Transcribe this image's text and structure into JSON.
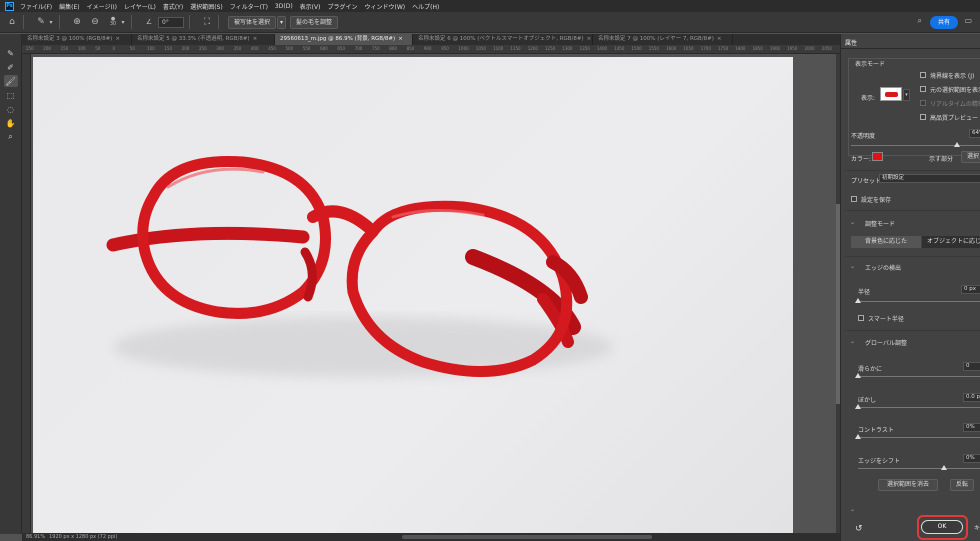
{
  "menu": {
    "logo": "Ps",
    "items": [
      "ファイル(F)",
      "編集(E)",
      "イメージ(I)",
      "レイヤー(L)",
      "書式(Y)",
      "選択範囲(S)",
      "フィルター(T)",
      "3D(D)",
      "表示(V)",
      "プラグイン",
      "ウィンドウ(W)",
      "ヘルプ(H)"
    ]
  },
  "options": {
    "size_value": "30",
    "angle_value": "0°",
    "select_subject": "被写体を選択",
    "refine_hair": "髪の毛を調整",
    "share": "共有"
  },
  "tabs": [
    {
      "label": "名称未設定 3 @ 100% (RGB/8#)",
      "active": false
    },
    {
      "label": "名称未設定 5 @ 33.3% (不透過明, RGB/8#)",
      "active": false
    },
    {
      "label": "29560613_m.jpg @ 86.9% (背景, RGB/8#)",
      "active": true
    },
    {
      "label": "名称未設定 6 @ 100% (ベクトルスマートオブジェクト, RGB/8#)",
      "active": false
    },
    {
      "label": "名称未設定 7 @ 100% (レイヤー 7, RGB/8#)",
      "active": false
    }
  ],
  "ruler_marks": [
    "250",
    "200",
    "150",
    "100",
    "50",
    "0",
    "50",
    "100",
    "150",
    "200",
    "250",
    "300",
    "350",
    "400",
    "450",
    "500",
    "550",
    "600",
    "650",
    "700",
    "750",
    "800",
    "850",
    "900",
    "950",
    "1000",
    "1050",
    "1100",
    "1150",
    "1200",
    "1250",
    "1300",
    "1350",
    "1400",
    "1450",
    "1500",
    "1550",
    "1600",
    "1650",
    "1700",
    "1750",
    "1800",
    "1850",
    "1900",
    "1950",
    "2000",
    "2050"
  ],
  "status": {
    "zoom": "86.91%",
    "dimensions": "1920 px x 1280 px (72 ppi)"
  },
  "panel": {
    "title": "属性",
    "view_mode_heading": "表示モード",
    "view_label": "表示:",
    "show_edges": "境界線を表示 (J)",
    "show_original": "元の選択範囲を表示",
    "realtime_refine": "リアルタイムの精密調整",
    "high_quality_preview": "高品質プレビュー",
    "opacity_label": "不透明度",
    "opacity_value": "64%",
    "color_label": "カラー:",
    "color_value": "#e5100f",
    "indicates_label": "示す部分",
    "indicates_value": "選択",
    "preset_label": "プリセット:",
    "preset_value": "初期設定",
    "remember_settings": "設定を保存",
    "adjust_mode_heading": "調整モード",
    "mode_color_aware": "背景色に応じた",
    "mode_object_aware": "オブジェクトに応じた",
    "edge_detection_heading": "エッジの検出",
    "radius_label": "半径",
    "radius_value": "0 px",
    "smart_radius": "スマート半径",
    "global_refine_heading": "グローバル調整",
    "smooth_label": "滑らかに",
    "smooth_value": "0",
    "feather_label": "ぼかし",
    "feather_value": "0.0 px",
    "contrast_label": "コントラスト",
    "contrast_value": "0%",
    "shift_edge_label": "エッジをシフト",
    "shift_edge_value": "0%",
    "clear_selection": "選択範囲を消去",
    "invert": "反転",
    "ok": "OK",
    "cancel_partial": "キ"
  }
}
